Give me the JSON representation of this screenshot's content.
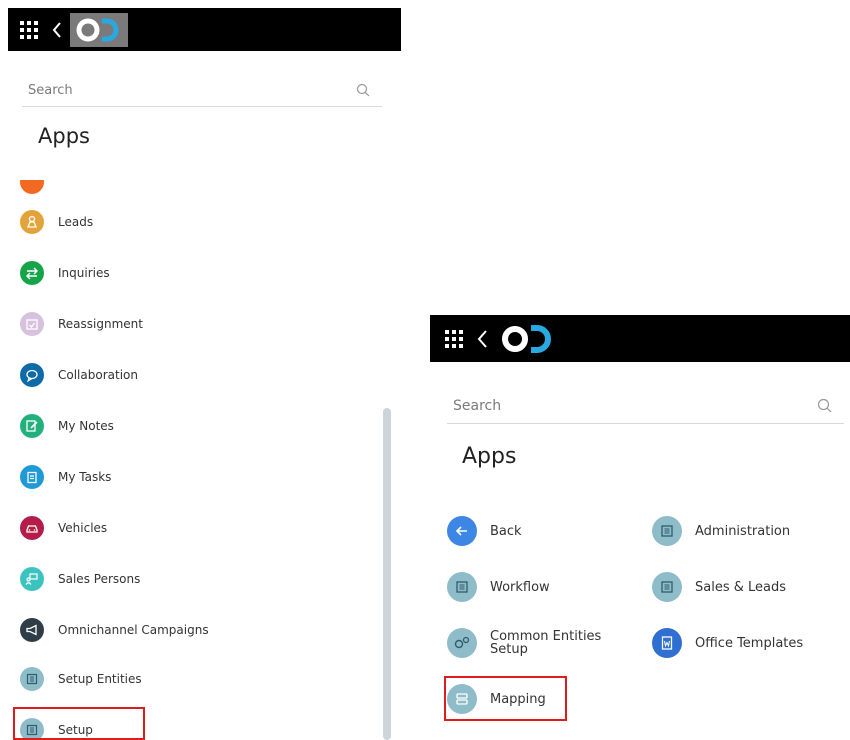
{
  "left_panel": {
    "search": {
      "placeholder": "Search"
    },
    "title": "Apps",
    "items": [
      {
        "label": "",
        "icon": "partial-app-icon",
        "color": "#f26a21"
      },
      {
        "label": "Leads",
        "icon": "person-pin-icon",
        "color": "#e3a33b"
      },
      {
        "label": "Inquiries",
        "icon": "swap-arrows-icon",
        "color": "#16a34a"
      },
      {
        "label": "Reassignment",
        "icon": "calendar-check-icon",
        "color": "#d7c1dd"
      },
      {
        "label": "Collaboration",
        "icon": "chat-bubbles-icon",
        "color": "#0f6aa8"
      },
      {
        "label": "My Notes",
        "icon": "note-pen-icon",
        "color": "#22b07d"
      },
      {
        "label": "My Tasks",
        "icon": "clipboard-icon",
        "color": "#1f9ad6"
      },
      {
        "label": "Vehicles",
        "icon": "car-icon",
        "color": "#b41c4a"
      },
      {
        "label": "Sales Persons",
        "icon": "presenter-icon",
        "color": "#3cc3c0"
      },
      {
        "label": "Omnichannel Campaigns",
        "icon": "megaphone-icon",
        "color": "#2f3e46"
      },
      {
        "label": "Setup Entities",
        "icon": "setup-sheet-icon",
        "color": "#8fbcc9"
      },
      {
        "label": "Setup",
        "icon": "setup-sheet-icon",
        "color": "#8fbcc9"
      }
    ]
  },
  "right_panel": {
    "search": {
      "placeholder": "Search"
    },
    "title": "Apps",
    "items": [
      {
        "label": "Back",
        "icon": "arrow-left-icon",
        "color": "#3d86e6"
      },
      {
        "label": "Administration",
        "icon": "setup-sheet-icon",
        "color": "#8fbcc9"
      },
      {
        "label": "Workflow",
        "icon": "setup-sheet-icon",
        "color": "#8fbcc9"
      },
      {
        "label": "Sales & Leads",
        "icon": "setup-sheet-icon",
        "color": "#8fbcc9"
      },
      {
        "label": "Common Entities Setup",
        "icon": "gears-icon",
        "color": "#8fbcc9"
      },
      {
        "label": "Office Templates",
        "icon": "word-document-icon",
        "color": "#2f6fd1"
      },
      {
        "label": "Mapping",
        "icon": "mapping-icon",
        "color": "#8fbcc9"
      }
    ]
  },
  "colors": {
    "topbar": "#000000",
    "highlight": "#e01d1d",
    "scrollbar": "#cdd4dc"
  }
}
